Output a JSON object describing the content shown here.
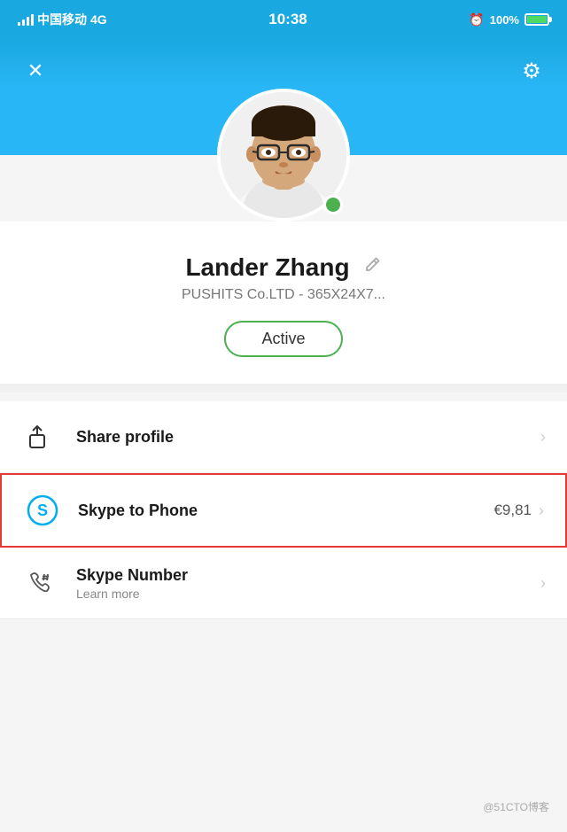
{
  "statusBar": {
    "carrier": "中国移动",
    "network": "4G",
    "time": "10:38",
    "battery": "100%"
  },
  "header": {
    "closeLabel": "✕",
    "settingsLabel": "⚙"
  },
  "profile": {
    "name": "Lander Zhang",
    "editIcon": "✏",
    "company": "PUSHITS Co.LTD - 365X24X7...",
    "status": "Active",
    "onlineStatus": "online"
  },
  "actions": [
    {
      "id": "share-profile",
      "title": "Share profile",
      "subtitle": "",
      "amount": "",
      "highlighted": false
    },
    {
      "id": "skype-to-phone",
      "title": "Skype to Phone",
      "subtitle": "",
      "amount": "€9,81",
      "highlighted": true
    },
    {
      "id": "skype-number",
      "title": "Skype Number",
      "subtitle": "Learn more",
      "amount": "",
      "highlighted": false
    }
  ],
  "watermark": "@51CTO博客"
}
